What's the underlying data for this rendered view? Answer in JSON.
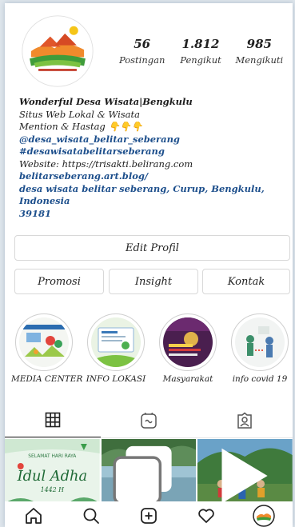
{
  "profile": {
    "stats": [
      {
        "value": "56",
        "label": "Postingan"
      },
      {
        "value": "1.812",
        "label": "Pengikut"
      },
      {
        "value": "985",
        "label": "Mengikuti"
      }
    ],
    "bio": {
      "name": "Wonderful Desa Wisata|Bengkulu",
      "category": "Situs Web Lokal & Wisata",
      "line1": "Mention & Hastag",
      "emoji": "👇👇👇",
      "mention": "@desa_wisata_belitar_seberang",
      "hashtag": "#desawisatabelitarseberang",
      "website_line": "Website: https://trisakti.belirang.com",
      "blog": "belitarseberang.art.blog/",
      "address_line1": "desa wisata belitar seberang, Curup, Bengkulu, Indonesia",
      "address_line2": "39181"
    }
  },
  "buttons": {
    "edit": "Edit Profil",
    "promosi": "Promosi",
    "insight": "Insight",
    "kontak": "Kontak"
  },
  "highlights": [
    {
      "label": "MEDIA CENTER"
    },
    {
      "label": "INFO LOKASI"
    },
    {
      "label": "Masyarakat"
    },
    {
      "label": "info covid 19"
    }
  ],
  "icons": {
    "tabs": [
      "grid-icon",
      "reels-icon",
      "tagged-icon"
    ],
    "nav": [
      "home-icon",
      "search-icon",
      "new-post-icon",
      "heart-icon",
      "profile-avatar-icon"
    ]
  },
  "posts": [
    {
      "title_line1": "SELAMAT HARI RAYA",
      "title_line2": "Idul Adha",
      "title_line3": "1442 H"
    },
    {},
    {}
  ],
  "colors": {
    "link": "#1d4f8c",
    "category": "#8a8a8a",
    "border": "#d8d8d8"
  }
}
